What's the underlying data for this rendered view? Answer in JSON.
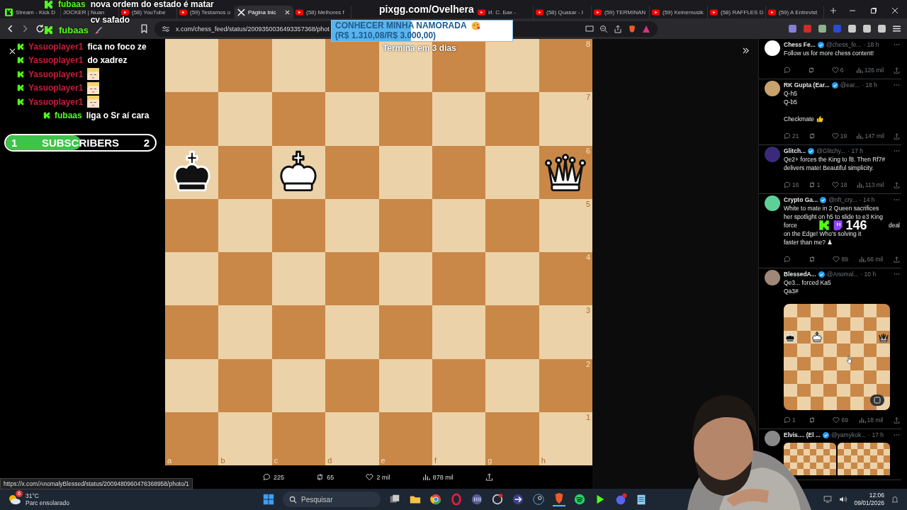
{
  "browser": {
    "tabs": [
      {
        "label": "Stream - Kick D",
        "kind": "kick",
        "selected": false
      },
      {
        "label": "JOCKER | Nuan",
        "kind": "none",
        "selected": false
      },
      {
        "label": "(58) YouTube",
        "kind": "youtube",
        "selected": false
      },
      {
        "label": "(59) Testamos o",
        "kind": "youtube",
        "selected": false
      },
      {
        "label": "Página Inic",
        "kind": "x",
        "selected": true
      },
      {
        "label": "(58) Melhores f",
        "kind": "youtube",
        "selected": false
      },
      {
        "label": "И. С. Бах -",
        "kind": "youtube",
        "selected": false
      },
      {
        "label": "(58) Quasar - I",
        "kind": "youtube",
        "selected": false
      },
      {
        "label": "(59) TERMINAN",
        "kind": "youtube",
        "selected": false
      },
      {
        "label": "(59) Keinemusik",
        "kind": "youtube",
        "selected": false
      },
      {
        "label": "(58) RAFFLES D",
        "kind": "youtube",
        "selected": false
      },
      {
        "label": "(59) A Entrevist",
        "kind": "youtube",
        "selected": false
      }
    ],
    "url": "x.com/chess_feed/status/2009350036493357368/phot",
    "status_url": "https://x.com/AnomalyBlessed/status/2009480960476368958/photo/1"
  },
  "overlay": {
    "top_message": {
      "user": "fubaas",
      "lines": [
        "nova ordem do estado é matar",
        "cv safado"
      ]
    },
    "bar_message": {
      "user": "fubaas"
    },
    "pix": "pixgg.com/Ovelhera",
    "goal": {
      "title": "CONHECER MINHA NAMORADA",
      "amount": "(R$ 1.310,08/R$ 3.000,00)",
      "level": 0.44
    },
    "viewers": "146",
    "chat": [
      {
        "user": "Yasuoplayer1",
        "color": "#c41e3a",
        "kind": "text",
        "text": "fica no foco ze",
        "indented": false
      },
      {
        "user": "Yasuoplayer1",
        "color": "#c41e3a",
        "kind": "text",
        "text": "do xadrez",
        "indented": false
      },
      {
        "user": "Yasuoplayer1",
        "color": "#c41e3a",
        "kind": "emote",
        "indented": false
      },
      {
        "user": "Yasuoplayer1",
        "color": "#c41e3a",
        "kind": "emote",
        "indented": false
      },
      {
        "user": "Yasuoplayer1",
        "color": "#c41e3a",
        "kind": "emote",
        "indented": false
      },
      {
        "user": "fubaas",
        "color": "#53fc18",
        "kind": "text",
        "text": "liga o Sr aí cara",
        "indented": true
      }
    ],
    "subs": {
      "start": "1",
      "label": "SUBSCRIBERS",
      "end": "2",
      "level": 0.5
    }
  },
  "post_view": {
    "countdown": "Termina em 3 dias",
    "board": {
      "files": [
        "a",
        "b",
        "c",
        "d",
        "e",
        "f",
        "g",
        "h"
      ],
      "ranks": [
        "8",
        "7",
        "6",
        "5",
        "4",
        "3",
        "2",
        "1"
      ]
    },
    "actions": {
      "replies": "225",
      "reposts": "65",
      "likes": "2 mil",
      "views": "878 mil"
    }
  },
  "feed": [
    {
      "name": "Chess Fe...",
      "handle": "@chess_fe...",
      "time": "· 18 h",
      "color": "#ffffff",
      "paragraphs": [
        [
          "Follow us for more chess content!"
        ]
      ],
      "stats": {
        "likes": "6",
        "views": "126 mil"
      }
    },
    {
      "name": "RK Gupta (Ear...",
      "handle": "@ear...",
      "time": "· 18 h",
      "color": "#c9a36b",
      "paragraphs": [
        [
          "Q-h5",
          "Q-b5"
        ],
        [
          "Checkmate"
        ]
      ],
      "thumbs": true,
      "stats": {
        "replies": "21",
        "likes": "19",
        "views": "147 mil"
      }
    },
    {
      "name": "Glitch...",
      "handle": "@Glitchy...",
      "time": "· 17 h",
      "color": "#3b2a7a",
      "paragraphs": [
        [
          "Qe2+ forces the King to f8. Then Rf7#",
          "delivers mate! Beautiful simplicity."
        ]
      ],
      "stats": {
        "replies": "16",
        "reposts": "1",
        "likes": "18",
        "views": "113 mil"
      }
    },
    {
      "name": "Crypto Ga...",
      "handle": "@nft_cry...",
      "time": "· 14 h",
      "color": "#5fcf9a",
      "paragraphs": [
        [
          "White to mate in 2 Queen sacrifices",
          "her spotlight on h5 to slide to e3 King",
          {
            "left": "force",
            "right": "deal"
          },
          "on the Edge! Who's solving it",
          "faster than me? ♟"
        ]
      ],
      "stats": {
        "likes": "89",
        "views": "66 mil"
      }
    },
    {
      "name": "BlessedA...",
      "handle": "@Anomal...",
      "time": "· 10 h",
      "color": "#a08878",
      "paragraphs": [
        [
          "Qe3... forced Ka5",
          "Qa3#"
        ]
      ],
      "image": {
        "kind": "board"
      },
      "stats": {
        "replies": "1",
        "likes": "69",
        "views": "18 mil"
      }
    },
    {
      "name": "Elvis.... (El ...",
      "handle": "@yamykok...",
      "time": "· 17 h",
      "color": "#888888",
      "image": {
        "kind": "boards"
      }
    }
  ],
  "taskbar": {
    "badge": "6",
    "temperature": "31°C",
    "weather": "Parc ensolarado",
    "search": {
      "placeholder": "Pesquisar"
    },
    "time": "12:06",
    "date": "09/01/2026"
  }
}
